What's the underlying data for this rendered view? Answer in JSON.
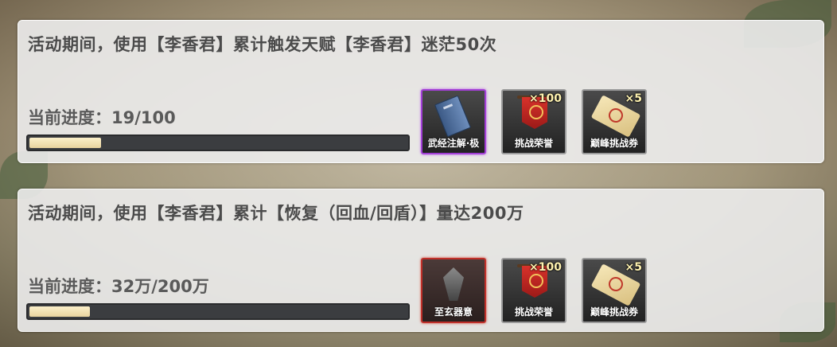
{
  "tasks": [
    {
      "title": "活动期间，使用【李香君】累计触发天赋【李香君】迷茫50次",
      "progress_text": "当前进度：19/100",
      "progress_fraction": 0.19,
      "rewards": [
        {
          "name": "武经注解·极",
          "count": "",
          "icon": "blue-book-icon",
          "rarity": "purple"
        },
        {
          "name": "挑战荣誉",
          "count": "×100",
          "icon": "red-banner-icon",
          "rarity": "normal"
        },
        {
          "name": "巅峰挑战券",
          "count": "×5",
          "icon": "ticket-icon",
          "rarity": "normal"
        }
      ]
    },
    {
      "title": "活动期间，使用【李香君】累计【恢复（回血/回盾）】量达200万",
      "progress_text": "当前进度：32万/200万",
      "progress_fraction": 0.16,
      "rewards": [
        {
          "name": "至玄器意",
          "count": "",
          "icon": "artifact-icon",
          "rarity": "red"
        },
        {
          "name": "挑战荣誉",
          "count": "×100",
          "icon": "red-banner-icon",
          "rarity": "normal"
        },
        {
          "name": "巅峰挑战券",
          "count": "×5",
          "icon": "ticket-icon",
          "rarity": "normal"
        }
      ]
    }
  ],
  "colors": {
    "panel_bg": "#ececec",
    "bar_fill": "#f3e2b1",
    "bar_track": "#3b3d40",
    "purple_rarity": "#a23fd6",
    "red_rarity": "#c0302a"
  }
}
